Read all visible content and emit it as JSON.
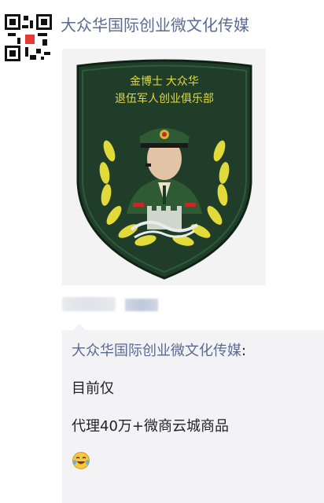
{
  "post": {
    "account_name": "大众华国际创业微文化传媒",
    "image": {
      "badge_line1": "金博士 大众华",
      "badge_line2": "退伍军人创业俱乐部"
    }
  },
  "comment": {
    "author": "大众华国际创业微文化传媒",
    "colon": ":",
    "line1": "目前仅",
    "line2": "代理40万+微商云城商品",
    "emoji_icon": "laughing-tears-emoji"
  },
  "colors": {
    "link_blue": "#5b6a91",
    "badge_green": "#1f3d28",
    "wreath_yellow": "#e2d93b",
    "comment_bg": "#f3f3f5"
  }
}
